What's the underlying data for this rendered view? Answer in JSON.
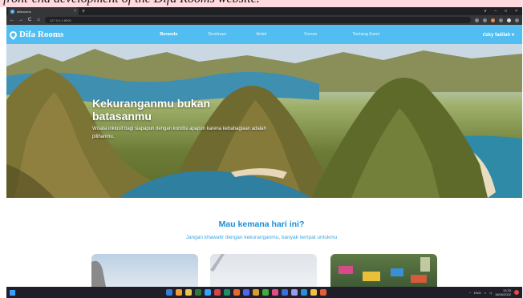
{
  "caption": {
    "text": "front-end development of the Difa Rooms website."
  },
  "browser": {
    "tab_title": "difarooms",
    "tab_close": "×",
    "new_tab": "+",
    "window_controls": [
      "v",
      "–",
      "□",
      "×"
    ],
    "back": "←",
    "forward": "→",
    "reload": "C",
    "home": "⌂",
    "url": "127.0.0.1:8000"
  },
  "nav": {
    "brand": "Difa Rooms",
    "links": [
      "Beranda",
      "Destinasi",
      "Hotel",
      "Forum",
      "Tentang Kami"
    ],
    "active_index": 0,
    "user": "rizky fadilah",
    "user_caret": "▾",
    "color": "#52bdf0"
  },
  "hero": {
    "title": "Kekuranganmu bukan batasanmu",
    "subtitle": "Wisata inklusif bagi siapapun dengan kondisi apapun karena kebahagiaan adalah pilihanmu."
  },
  "section": {
    "title": "Mau kemana hari ini?",
    "subtitle": "Jangan khawatir dengan kekuranganmu, banyak tempat untukmu",
    "title_color": "#1a8fd6"
  },
  "taskbar": {
    "tray_lang": "ENG",
    "time": "13.33",
    "date": "18/06/2022",
    "apps": [
      "#3a7bd5",
      "#f0a030",
      "#e8c84a",
      "#2b7a3a",
      "#3aa0ff",
      "#d64545",
      "#1a8f6a",
      "#e86a2a",
      "#5566ee",
      "#d6a12a",
      "#44aa44",
      "#e04e8a",
      "#3b6fd8",
      "#9a9aee",
      "#2a8fd6",
      "#f2c04a",
      "#e35d3b"
    ]
  }
}
